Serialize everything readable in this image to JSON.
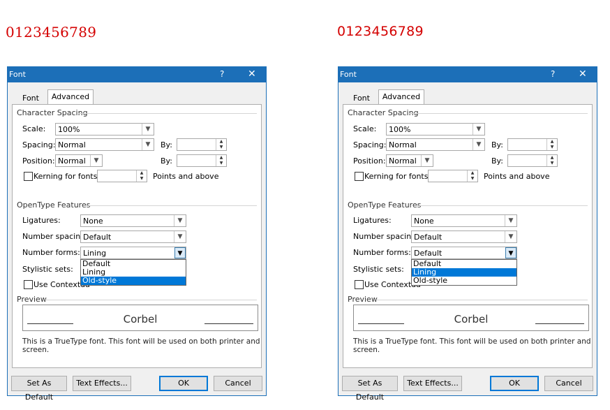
{
  "samples": {
    "left": "0123456789",
    "right": "0123456789"
  },
  "colors": {
    "title_bar": "#1c6fb8",
    "sample_text": "#d40000",
    "selection": "#0078d7"
  },
  "dialogs": [
    {
      "title": "Font",
      "help": "?",
      "close": "✕",
      "tabs": {
        "font": "Font",
        "advanced": "Advanced",
        "active": "Advanced"
      },
      "character_spacing": {
        "heading": "Character Spacing",
        "scale_label": "Scale:",
        "scale_value": "100%",
        "spacing_label": "Spacing:",
        "spacing_value": "Normal",
        "spacing_by_label": "By:",
        "position_label": "Position:",
        "position_value": "Normal",
        "position_by_label": "By:",
        "kerning_label": "Kerning for fonts:",
        "kerning_suffix": "Points and above"
      },
      "opentype": {
        "heading": "OpenType Features",
        "ligatures_label": "Ligatures:",
        "ligatures_value": "None",
        "number_spacing_label": "Number spacing:",
        "number_spacing_value": "Default",
        "number_forms_label": "Number forms:",
        "number_forms_value": "Lining",
        "number_forms_options": [
          "Default",
          "Lining",
          "Old-style"
        ],
        "number_forms_highlighted": "Old-style",
        "stylistic_sets_label": "Stylistic sets:",
        "contextual_label": "Use Contextua"
      },
      "preview": {
        "heading": "Preview",
        "text": "Corbel",
        "info": "This is a TrueType font. This font will be used on both printer and screen."
      },
      "buttons": {
        "set_default": "Set As Default",
        "text_effects": "Text Effects...",
        "ok": "OK",
        "cancel": "Cancel"
      }
    },
    {
      "title": "Font",
      "help": "?",
      "close": "✕",
      "tabs": {
        "font": "Font",
        "advanced": "Advanced",
        "active": "Advanced"
      },
      "character_spacing": {
        "heading": "Character Spacing",
        "scale_label": "Scale:",
        "scale_value": "100%",
        "spacing_label": "Spacing:",
        "spacing_value": "Normal",
        "spacing_by_label": "By:",
        "position_label": "Position:",
        "position_value": "Normal",
        "position_by_label": "By:",
        "kerning_label": "Kerning for fonts:",
        "kerning_suffix": "Points and above"
      },
      "opentype": {
        "heading": "OpenType Features",
        "ligatures_label": "Ligatures:",
        "ligatures_value": "None",
        "number_spacing_label": "Number spacing:",
        "number_spacing_value": "Default",
        "number_forms_label": "Number forms:",
        "number_forms_value": "Default",
        "number_forms_options": [
          "Default",
          "Lining",
          "Old-style"
        ],
        "number_forms_highlighted": "Lining",
        "stylistic_sets_label": "Stylistic sets:",
        "contextual_label": "Use Contextua"
      },
      "preview": {
        "heading": "Preview",
        "text": "Corbel",
        "info": "This is a TrueType font. This font will be used on both printer and screen."
      },
      "buttons": {
        "set_default": "Set As Default",
        "text_effects": "Text Effects...",
        "ok": "OK",
        "cancel": "Cancel"
      }
    }
  ]
}
